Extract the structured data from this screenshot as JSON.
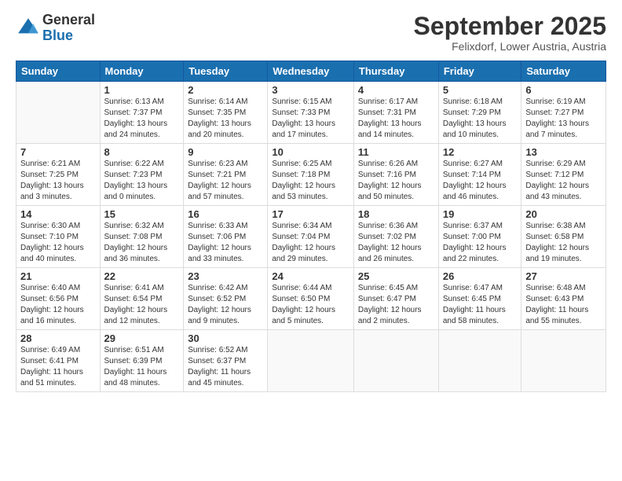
{
  "logo": {
    "general": "General",
    "blue": "Blue"
  },
  "header": {
    "month": "September 2025",
    "location": "Felixdorf, Lower Austria, Austria"
  },
  "weekdays": [
    "Sunday",
    "Monday",
    "Tuesday",
    "Wednesday",
    "Thursday",
    "Friday",
    "Saturday"
  ],
  "weeks": [
    [
      {
        "day": "",
        "sunrise": "",
        "sunset": "",
        "daylight": ""
      },
      {
        "day": "1",
        "sunrise": "Sunrise: 6:13 AM",
        "sunset": "Sunset: 7:37 PM",
        "daylight": "Daylight: 13 hours and 24 minutes."
      },
      {
        "day": "2",
        "sunrise": "Sunrise: 6:14 AM",
        "sunset": "Sunset: 7:35 PM",
        "daylight": "Daylight: 13 hours and 20 minutes."
      },
      {
        "day": "3",
        "sunrise": "Sunrise: 6:15 AM",
        "sunset": "Sunset: 7:33 PM",
        "daylight": "Daylight: 13 hours and 17 minutes."
      },
      {
        "day": "4",
        "sunrise": "Sunrise: 6:17 AM",
        "sunset": "Sunset: 7:31 PM",
        "daylight": "Daylight: 13 hours and 14 minutes."
      },
      {
        "day": "5",
        "sunrise": "Sunrise: 6:18 AM",
        "sunset": "Sunset: 7:29 PM",
        "daylight": "Daylight: 13 hours and 10 minutes."
      },
      {
        "day": "6",
        "sunrise": "Sunrise: 6:19 AM",
        "sunset": "Sunset: 7:27 PM",
        "daylight": "Daylight: 13 hours and 7 minutes."
      }
    ],
    [
      {
        "day": "7",
        "sunrise": "Sunrise: 6:21 AM",
        "sunset": "Sunset: 7:25 PM",
        "daylight": "Daylight: 13 hours and 3 minutes."
      },
      {
        "day": "8",
        "sunrise": "Sunrise: 6:22 AM",
        "sunset": "Sunset: 7:23 PM",
        "daylight": "Daylight: 13 hours and 0 minutes."
      },
      {
        "day": "9",
        "sunrise": "Sunrise: 6:23 AM",
        "sunset": "Sunset: 7:21 PM",
        "daylight": "Daylight: 12 hours and 57 minutes."
      },
      {
        "day": "10",
        "sunrise": "Sunrise: 6:25 AM",
        "sunset": "Sunset: 7:18 PM",
        "daylight": "Daylight: 12 hours and 53 minutes."
      },
      {
        "day": "11",
        "sunrise": "Sunrise: 6:26 AM",
        "sunset": "Sunset: 7:16 PM",
        "daylight": "Daylight: 12 hours and 50 minutes."
      },
      {
        "day": "12",
        "sunrise": "Sunrise: 6:27 AM",
        "sunset": "Sunset: 7:14 PM",
        "daylight": "Daylight: 12 hours and 46 minutes."
      },
      {
        "day": "13",
        "sunrise": "Sunrise: 6:29 AM",
        "sunset": "Sunset: 7:12 PM",
        "daylight": "Daylight: 12 hours and 43 minutes."
      }
    ],
    [
      {
        "day": "14",
        "sunrise": "Sunrise: 6:30 AM",
        "sunset": "Sunset: 7:10 PM",
        "daylight": "Daylight: 12 hours and 40 minutes."
      },
      {
        "day": "15",
        "sunrise": "Sunrise: 6:32 AM",
        "sunset": "Sunset: 7:08 PM",
        "daylight": "Daylight: 12 hours and 36 minutes."
      },
      {
        "day": "16",
        "sunrise": "Sunrise: 6:33 AM",
        "sunset": "Sunset: 7:06 PM",
        "daylight": "Daylight: 12 hours and 33 minutes."
      },
      {
        "day": "17",
        "sunrise": "Sunrise: 6:34 AM",
        "sunset": "Sunset: 7:04 PM",
        "daylight": "Daylight: 12 hours and 29 minutes."
      },
      {
        "day": "18",
        "sunrise": "Sunrise: 6:36 AM",
        "sunset": "Sunset: 7:02 PM",
        "daylight": "Daylight: 12 hours and 26 minutes."
      },
      {
        "day": "19",
        "sunrise": "Sunrise: 6:37 AM",
        "sunset": "Sunset: 7:00 PM",
        "daylight": "Daylight: 12 hours and 22 minutes."
      },
      {
        "day": "20",
        "sunrise": "Sunrise: 6:38 AM",
        "sunset": "Sunset: 6:58 PM",
        "daylight": "Daylight: 12 hours and 19 minutes."
      }
    ],
    [
      {
        "day": "21",
        "sunrise": "Sunrise: 6:40 AM",
        "sunset": "Sunset: 6:56 PM",
        "daylight": "Daylight: 12 hours and 16 minutes."
      },
      {
        "day": "22",
        "sunrise": "Sunrise: 6:41 AM",
        "sunset": "Sunset: 6:54 PM",
        "daylight": "Daylight: 12 hours and 12 minutes."
      },
      {
        "day": "23",
        "sunrise": "Sunrise: 6:42 AM",
        "sunset": "Sunset: 6:52 PM",
        "daylight": "Daylight: 12 hours and 9 minutes."
      },
      {
        "day": "24",
        "sunrise": "Sunrise: 6:44 AM",
        "sunset": "Sunset: 6:50 PM",
        "daylight": "Daylight: 12 hours and 5 minutes."
      },
      {
        "day": "25",
        "sunrise": "Sunrise: 6:45 AM",
        "sunset": "Sunset: 6:47 PM",
        "daylight": "Daylight: 12 hours and 2 minutes."
      },
      {
        "day": "26",
        "sunrise": "Sunrise: 6:47 AM",
        "sunset": "Sunset: 6:45 PM",
        "daylight": "Daylight: 11 hours and 58 minutes."
      },
      {
        "day": "27",
        "sunrise": "Sunrise: 6:48 AM",
        "sunset": "Sunset: 6:43 PM",
        "daylight": "Daylight: 11 hours and 55 minutes."
      }
    ],
    [
      {
        "day": "28",
        "sunrise": "Sunrise: 6:49 AM",
        "sunset": "Sunset: 6:41 PM",
        "daylight": "Daylight: 11 hours and 51 minutes."
      },
      {
        "day": "29",
        "sunrise": "Sunrise: 6:51 AM",
        "sunset": "Sunset: 6:39 PM",
        "daylight": "Daylight: 11 hours and 48 minutes."
      },
      {
        "day": "30",
        "sunrise": "Sunrise: 6:52 AM",
        "sunset": "Sunset: 6:37 PM",
        "daylight": "Daylight: 11 hours and 45 minutes."
      },
      {
        "day": "",
        "sunrise": "",
        "sunset": "",
        "daylight": ""
      },
      {
        "day": "",
        "sunrise": "",
        "sunset": "",
        "daylight": ""
      },
      {
        "day": "",
        "sunrise": "",
        "sunset": "",
        "daylight": ""
      },
      {
        "day": "",
        "sunrise": "",
        "sunset": "",
        "daylight": ""
      }
    ]
  ]
}
